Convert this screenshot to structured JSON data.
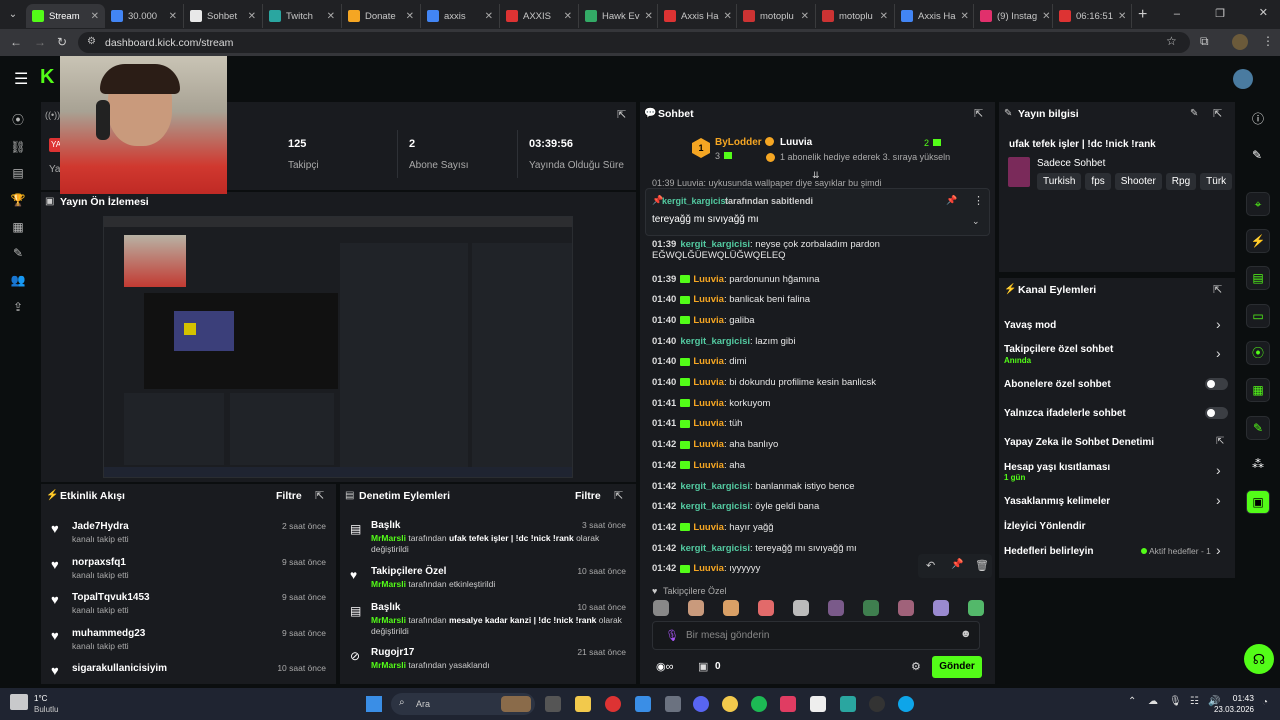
{
  "browser": {
    "tabs": [
      {
        "label": "Stream",
        "color": "#53fc18",
        "active": true
      },
      {
        "label": "30.000",
        "color": "#4285f4"
      },
      {
        "label": "Sohbet",
        "color": "#e8e8e8"
      },
      {
        "label": "Twitch",
        "color": "#2aa6a0"
      },
      {
        "label": "Donate",
        "color": "#f5a623"
      },
      {
        "label": "axxis",
        "color": "#4285f4"
      },
      {
        "label": "AXXIS",
        "color": "#d33"
      },
      {
        "label": "Hawk Ev",
        "color": "#3a6"
      },
      {
        "label": "Axxis Ha",
        "color": "#d33"
      },
      {
        "label": "motoplu",
        "color": "#c33"
      },
      {
        "label": "motoplu",
        "color": "#c33"
      },
      {
        "label": "Axxis Ha",
        "color": "#4285f4"
      },
      {
        "label": "(9) Instag",
        "color": "#e1306c"
      },
      {
        "label": "06:16:51",
        "color": "#d33"
      }
    ],
    "url": "dashboard.kick.com/stream"
  },
  "stats": {
    "followers": "125",
    "followers_label": "Takipçi",
    "subs": "2",
    "subs_label": "Abone Sayısı",
    "uptime": "03:39:56",
    "uptime_label": "Yayında Olduğu Süre"
  },
  "preview": {
    "title": "Yayın Ön İzlemesi"
  },
  "chat": {
    "title": "Sohbet",
    "top_user": "ByLodder",
    "top_rank": "1",
    "top_count": "3",
    "top_user2": "Luuvia",
    "top_count2": "2",
    "top_note": "1 abonelik hediye ederek 3. sıraya yükseln",
    "pinned_by": "kergit_kargicisi",
    "pinned_suffix": "tarafından sabitlendi",
    "pinned_msg": "tereyağğ mı sıvıyağğ mı",
    "partial_top": "01:39  Luuvia: uykusunda wallpaper diye sayıklar bu şimdi",
    "messages": [
      {
        "time": "01:39",
        "user": "kergit_kargicisi",
        "color": "g",
        "text": ": neyse çok zorbaladım pardon",
        "text2": "EĞWQLĞÜEWQLÜĞWQELEQ"
      },
      {
        "time": "01:39",
        "user": "Luuvia",
        "color": "o",
        "text": ": pardonunun hğamına"
      },
      {
        "time": "01:40",
        "user": "Luuvia",
        "color": "o",
        "text": ": banlicak beni falina"
      },
      {
        "time": "01:40",
        "user": "Luuvia",
        "color": "o",
        "text": ": galiba"
      },
      {
        "time": "01:40",
        "user": "kergit_kargicisi",
        "color": "g",
        "text": ": lazım gibi"
      },
      {
        "time": "01:40",
        "user": "Luuvia",
        "color": "o",
        "text": ": dimi"
      },
      {
        "time": "01:40",
        "user": "Luuvia",
        "color": "o",
        "text": ": bi dokundu profilime kesin banlicsk"
      },
      {
        "time": "01:41",
        "user": "Luuvia",
        "color": "o",
        "text": ": korkuyom"
      },
      {
        "time": "01:41",
        "user": "Luuvia",
        "color": "o",
        "text": ": tüh"
      },
      {
        "time": "01:42",
        "user": "Luuvia",
        "color": "o",
        "text": ": aha banlıyo"
      },
      {
        "time": "01:42",
        "user": "Luuvia",
        "color": "o",
        "text": ": aha"
      },
      {
        "time": "01:42",
        "user": "kergit_kargicisi",
        "color": "g",
        "text": ": banlanmak istiyo bence"
      },
      {
        "time": "01:42",
        "user": "kergit_kargicisi",
        "color": "g",
        "text": ": öyle geldi bana"
      },
      {
        "time": "01:42",
        "user": "Luuvia",
        "color": "o",
        "text": ": hayır yağğ"
      },
      {
        "time": "01:42",
        "user": "kergit_kargicisi",
        "color": "g",
        "text": ": tereyağğ mı sıvıyağğ mı"
      },
      {
        "time": "01:42",
        "user": "Luuvia",
        "color": "o",
        "text": ": ıyyyyyy"
      }
    ],
    "followers_only": "Takipçilere Özel",
    "input_placeholder": "Bir mesaj gönderin",
    "points": "0",
    "send": "Gönder"
  },
  "info": {
    "title": "Yayın bilgisi",
    "stream_title": "ufak tefek işler | !dc !nick !rank",
    "category": "Sadece Sohbet",
    "tags": [
      "Turkish",
      "fps",
      "Shooter",
      "Rpg",
      "Türk"
    ]
  },
  "actions": {
    "title": "Kanal Eylemleri",
    "slow": "Yavaş mod",
    "followers": "Takipçilere özel sohbet",
    "followers_sub": "Anında",
    "subs": "Abonelere özel sohbet",
    "emotes": "Yalnızca ifadelerle sohbet",
    "ai": "Yapay Zeka ile Sohbet Denetimi",
    "age": "Hesap yaşı kısıtlaması",
    "age_sub": "1 gün",
    "banned": "Yasaklanmış kelimeler",
    "redirect": "İzleyici Yönlendir",
    "goals": "Hedefleri belirleyin",
    "goals_status": "Aktif hedefler - 1"
  },
  "activity": {
    "title": "Etkinlik Akışı",
    "filter": "Filtre",
    "items": [
      {
        "name": "Jade7Hydra",
        "sub": "kanalı takip etti",
        "time": "2 saat önce"
      },
      {
        "name": "norpaxsfq1",
        "sub": "kanalı takip etti",
        "time": "9 saat önce"
      },
      {
        "name": "TopalTqvuk1453",
        "sub": "kanalı takip etti",
        "time": "9 saat önce"
      },
      {
        "name": "muhammedg23",
        "sub": "kanalı takip etti",
        "time": "9 saat önce"
      },
      {
        "name": "sigarakullanicisiyim",
        "sub": "",
        "time": "10 saat önce"
      }
    ]
  },
  "moderation": {
    "title": "Denetim Eylemleri",
    "filter": "Filtre",
    "items": [
      {
        "title": "Başlık",
        "time": "3 saat önce",
        "who": "MrMarsli",
        "desc": " tarafından ",
        "bold": "ufak tefek işler | !dc !nick !rank",
        "rest": " olarak",
        "line2": "değiştirildi"
      },
      {
        "title": "Takipçilere Özel",
        "time": "10 saat önce",
        "who": "MrMarsli",
        "desc": " tarafından etkinleştirildi",
        "bold": "",
        "rest": "",
        "line2": ""
      },
      {
        "title": "Başlık",
        "time": "10 saat önce",
        "who": "MrMarsli",
        "desc": " tarafından ",
        "bold": "mesalye kadar kanzi | !dc !nick !rank",
        "rest": " olarak",
        "line2": "değiştirildi"
      },
      {
        "title": "Rugojr17",
        "time": "21 saat önce",
        "who": "MrMarsli",
        "desc": " tarafından yasaklandı",
        "bold": "",
        "rest": "",
        "line2": ""
      }
    ]
  },
  "taskbar": {
    "weather": "1°C",
    "weather_sub": "Bulutlu",
    "search": "Ara",
    "time": "01:43",
    "date": "23.03.2026"
  }
}
